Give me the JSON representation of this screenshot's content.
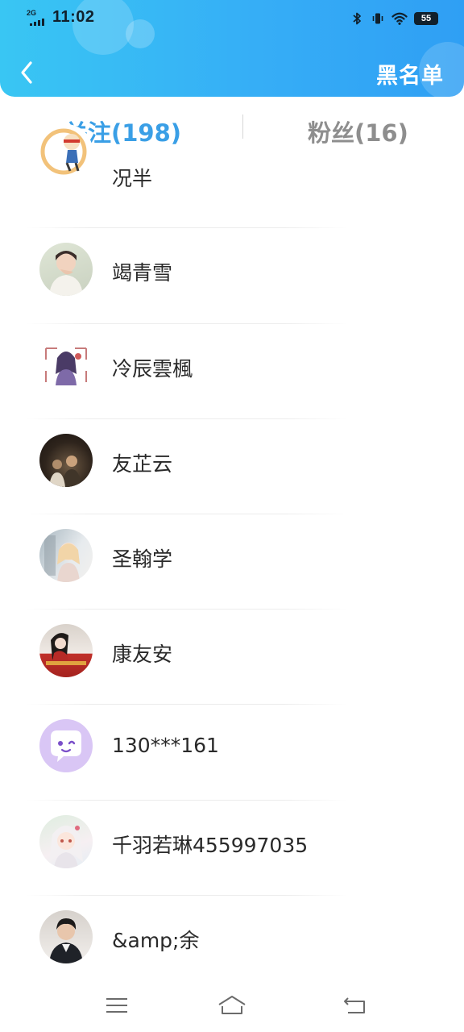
{
  "status_bar": {
    "network": "2G",
    "time": "11:02",
    "battery": "55",
    "icons": [
      "bluetooth-icon",
      "vibrate-icon",
      "wifi-icon",
      "battery-icon"
    ]
  },
  "header": {
    "back_icon": "chevron-left-icon",
    "action_label": "黑名单",
    "gradient_start": "#39c6f3",
    "gradient_end": "#2f9ff4"
  },
  "tabs": [
    {
      "label": "关注(198)",
      "active": true
    },
    {
      "label": "粉丝(16)",
      "active": false
    }
  ],
  "colors": {
    "accent": "#3a9fe6",
    "tab_inactive": "#8e8e8e"
  },
  "list": {
    "items": [
      {
        "name": "况半"
      },
      {
        "name": "竭青雪"
      },
      {
        "name": "冷辰雲楓"
      },
      {
        "name": "友芷云"
      },
      {
        "name": "圣翰学"
      },
      {
        "name": "康友安"
      },
      {
        "name": "130***161"
      },
      {
        "name": "千羽若琳455997035"
      },
      {
        "name": "&amp;余"
      }
    ]
  },
  "nav_bar": {
    "icons": [
      "menu-icon",
      "home-icon",
      "back-icon"
    ]
  }
}
